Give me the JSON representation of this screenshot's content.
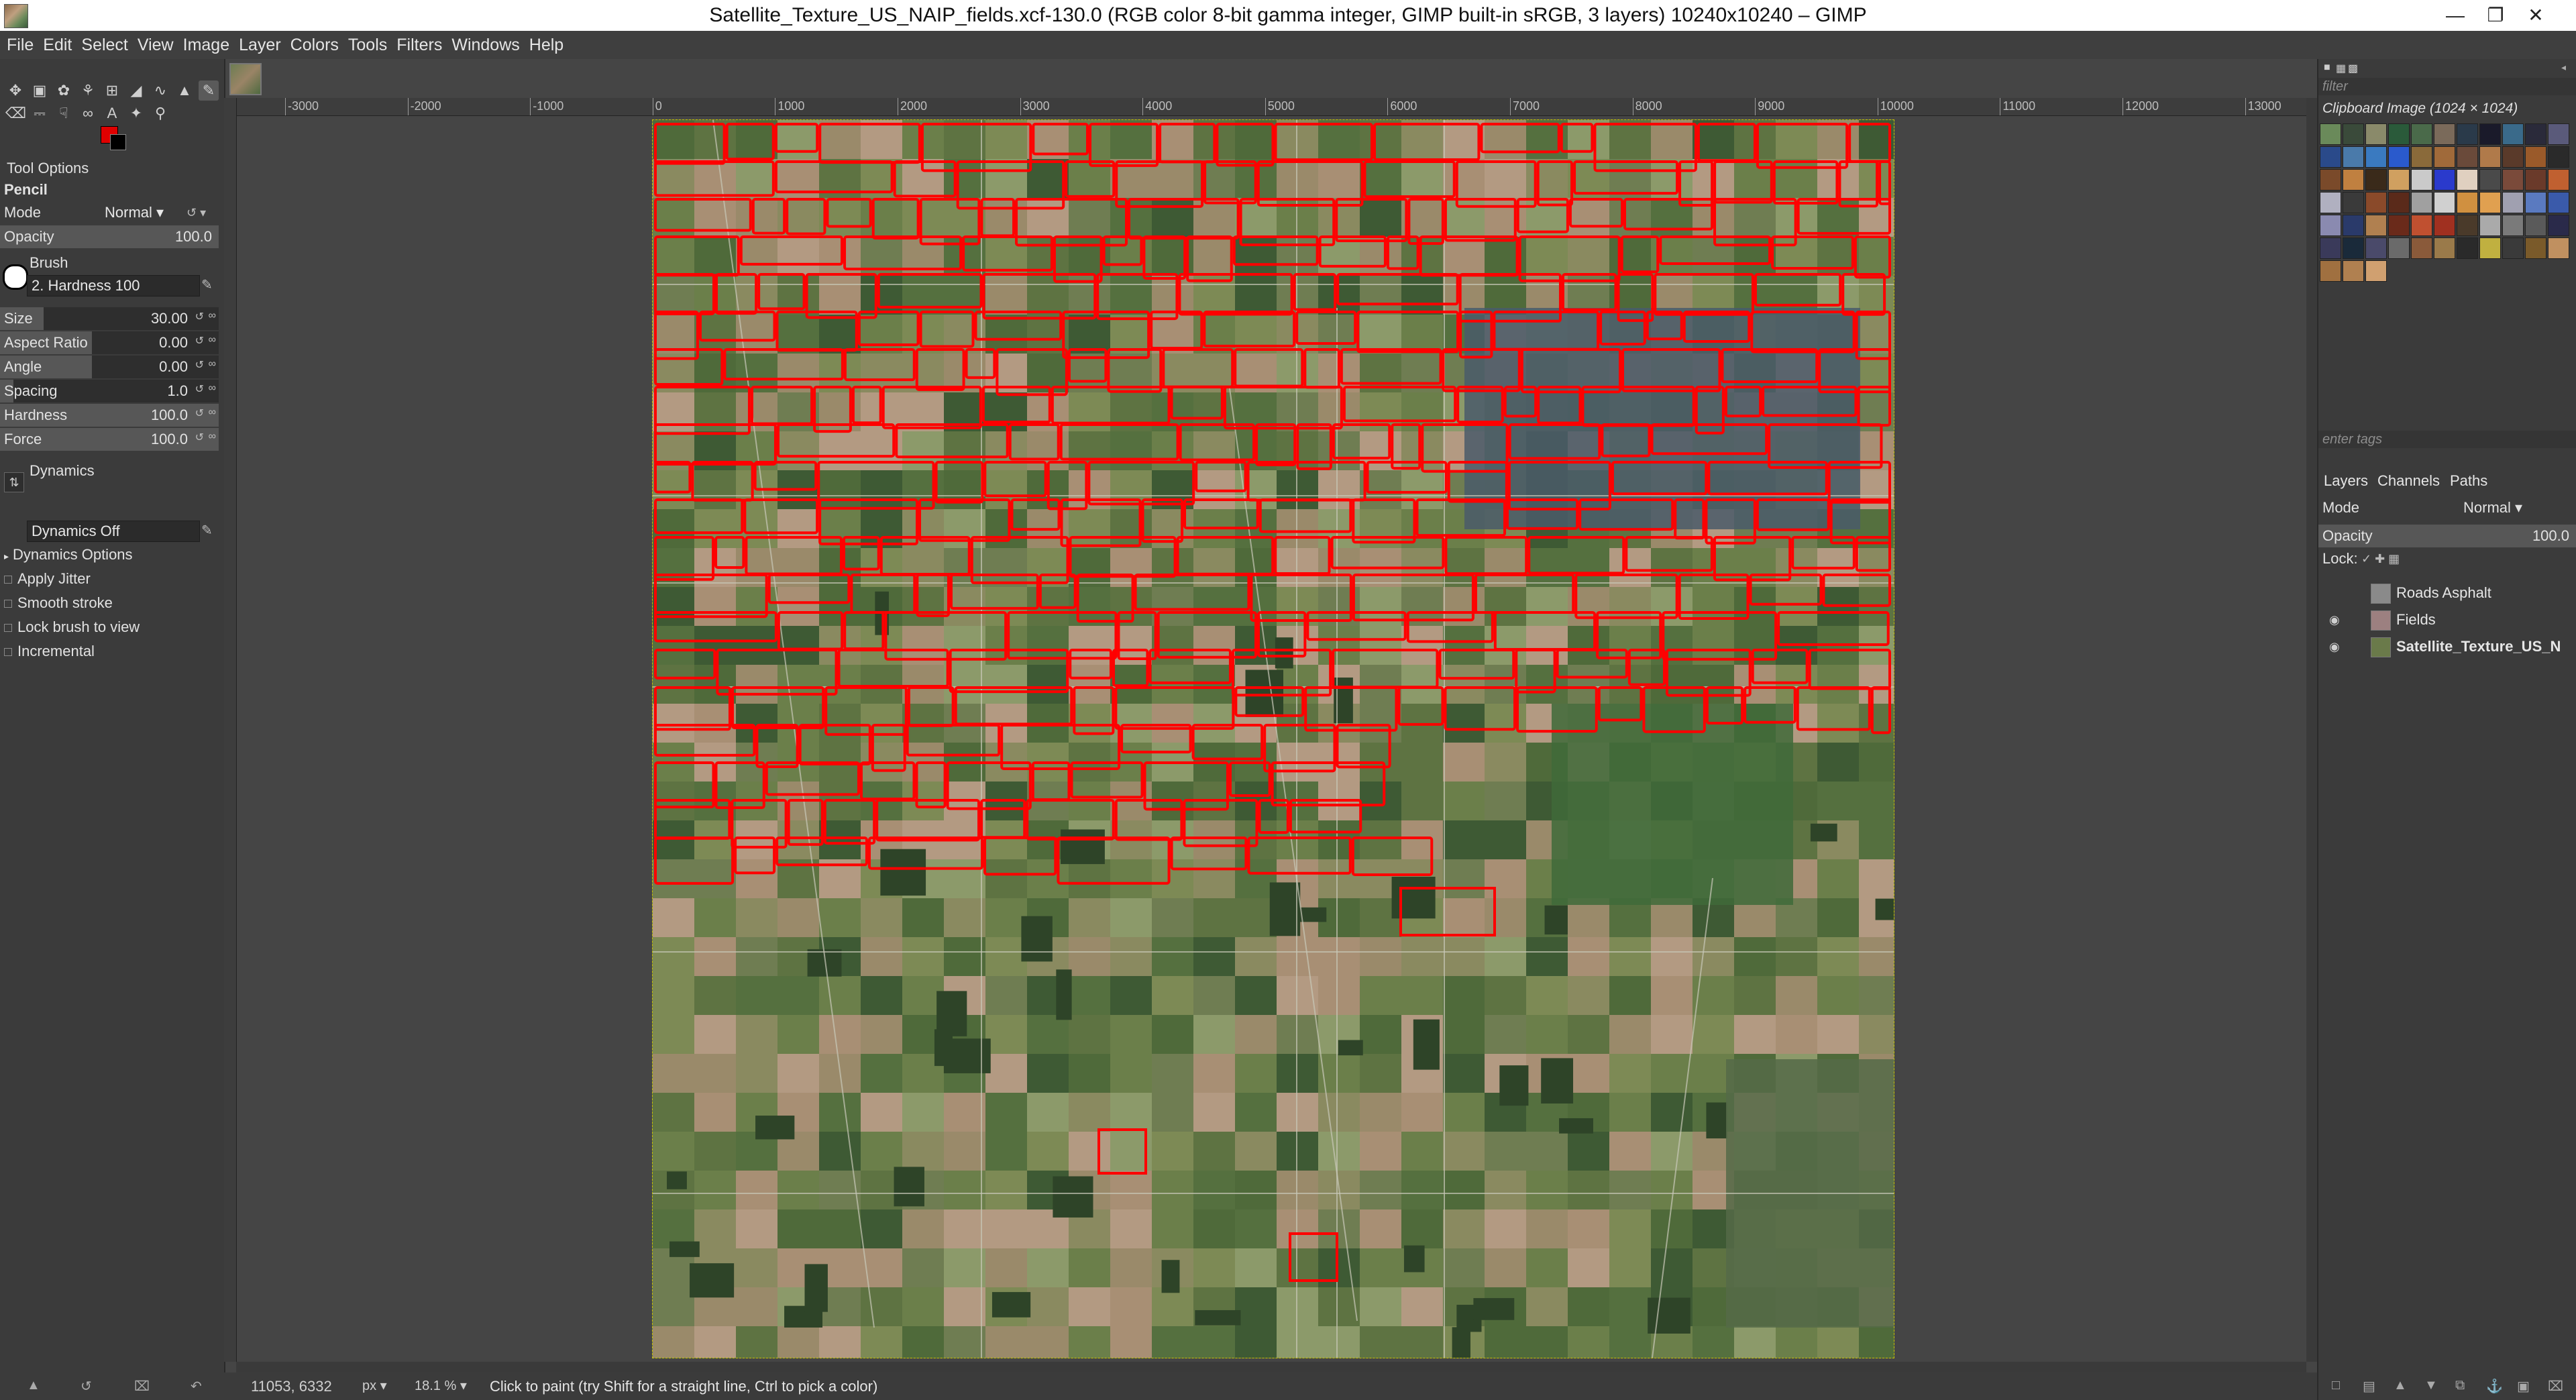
{
  "window": {
    "title": "Satellite_Texture_US_NAIP_fields.xcf-130.0 (RGB color 8-bit gamma integer, GIMP built-in sRGB, 3 layers) 10240x10240 – GIMP",
    "minimize_icon": "minimize-icon",
    "maximize_icon": "restore-icon",
    "close_icon": "close-icon"
  },
  "menu": [
    "File",
    "Edit",
    "Select",
    "View",
    "Image",
    "Layer",
    "Colors",
    "Tools",
    "Filters",
    "Windows",
    "Help"
  ],
  "tool_options": {
    "panel_title": "Tool Options",
    "tool_name": "Pencil",
    "mode_label": "Mode",
    "mode_value": "Normal",
    "opacity_label": "Opacity",
    "opacity_value": "100.0",
    "brush_label": "Brush",
    "brush_value": "2. Hardness 100",
    "size_label": "Size",
    "size_value": "30.00",
    "aspect_label": "Aspect Ratio",
    "aspect_value": "0.00",
    "angle_label": "Angle",
    "angle_value": "0.00",
    "spacing_label": "Spacing",
    "spacing_value": "1.0",
    "hardness_label": "Hardness",
    "hardness_value": "100.0",
    "force_label": "Force",
    "force_value": "100.0",
    "dynamics_label": "Dynamics",
    "dynamics_value": "Dynamics Off",
    "dynamics_options": "Dynamics Options",
    "apply_jitter": "Apply Jitter",
    "smooth_stroke": "Smooth stroke",
    "lock_brush": "Lock brush to view",
    "incremental": "Incremental"
  },
  "ruler": {
    "labels": [
      "-3000",
      "-2000",
      "-1000",
      "0",
      "1000",
      "2000",
      "3000",
      "4000",
      "5000",
      "6000",
      "7000",
      "8000",
      "9000",
      "10000",
      "11000",
      "12000",
      "13000"
    ]
  },
  "status": {
    "coords": "11053, 6332",
    "unit": "px",
    "zoom": "18.1 %",
    "message": "Click to paint (try Shift for a straight line, Ctrl to pick a color)"
  },
  "patterns": {
    "filter_placeholder": "filter",
    "selected_name": "Clipboard Image (1024 × 1024)",
    "tags_placeholder": "enter tags"
  },
  "layers": {
    "tabs": [
      "Layers",
      "Channels",
      "Paths"
    ],
    "mode_label": "Mode",
    "mode_value": "Normal",
    "opacity_label": "Opacity",
    "opacity_value": "100.0",
    "lock_label": "Lock:",
    "items": [
      {
        "name": "Roads Asphalt",
        "visible": false
      },
      {
        "name": "Fields",
        "visible": true
      },
      {
        "name": "Satellite_Texture_US_N",
        "visible": true
      }
    ]
  },
  "colors": {
    "fg": "#e00000",
    "bg": "#000000",
    "outline": "#ff0000"
  }
}
